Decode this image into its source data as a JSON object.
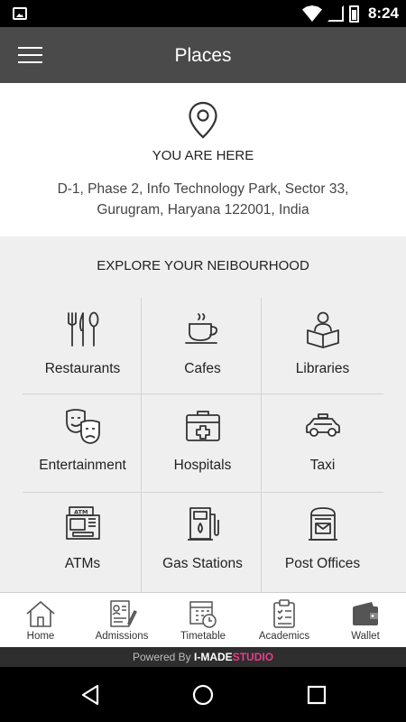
{
  "status_bar": {
    "time": "8:24"
  },
  "app_bar": {
    "title": "Places"
  },
  "location": {
    "label": "YOU ARE HERE",
    "address_line1": "D-1, Phase 2, Info Technology Park, Sector 33,",
    "address_line2": "Gurugram, Haryana 122001, India"
  },
  "explore": {
    "heading": "EXPLORE YOUR NEIBOURHOOD",
    "items": [
      {
        "label": "Restaurants",
        "icon": "restaurant-icon"
      },
      {
        "label": "Cafes",
        "icon": "coffee-cup-icon"
      },
      {
        "label": "Libraries",
        "icon": "library-reader-icon"
      },
      {
        "label": "Entertainment",
        "icon": "theater-masks-icon"
      },
      {
        "label": "Hospitals",
        "icon": "first-aid-kit-icon"
      },
      {
        "label": "Taxi",
        "icon": "taxi-icon"
      },
      {
        "label": "ATMs",
        "icon": "atm-icon"
      },
      {
        "label": "Gas Stations",
        "icon": "fuel-pump-icon"
      },
      {
        "label": "Post Offices",
        "icon": "mailbox-icon"
      }
    ]
  },
  "bottom_nav": [
    {
      "label": "Home",
      "icon": "home-icon"
    },
    {
      "label": "Admissions",
      "icon": "admissions-form-icon"
    },
    {
      "label": "Timetable",
      "icon": "calendar-clock-icon"
    },
    {
      "label": "Academics",
      "icon": "clipboard-checklist-icon"
    },
    {
      "label": "Wallet",
      "icon": "wallet-icon"
    }
  ],
  "powered_by": {
    "prefix": "Powered By",
    "brand_part1": "I-MADE",
    "brand_part2": "STUDIO"
  },
  "colors": {
    "app_bar": "#4a4a4a",
    "explore_bg": "#efefef",
    "brand_accent": "#e63c8a"
  }
}
